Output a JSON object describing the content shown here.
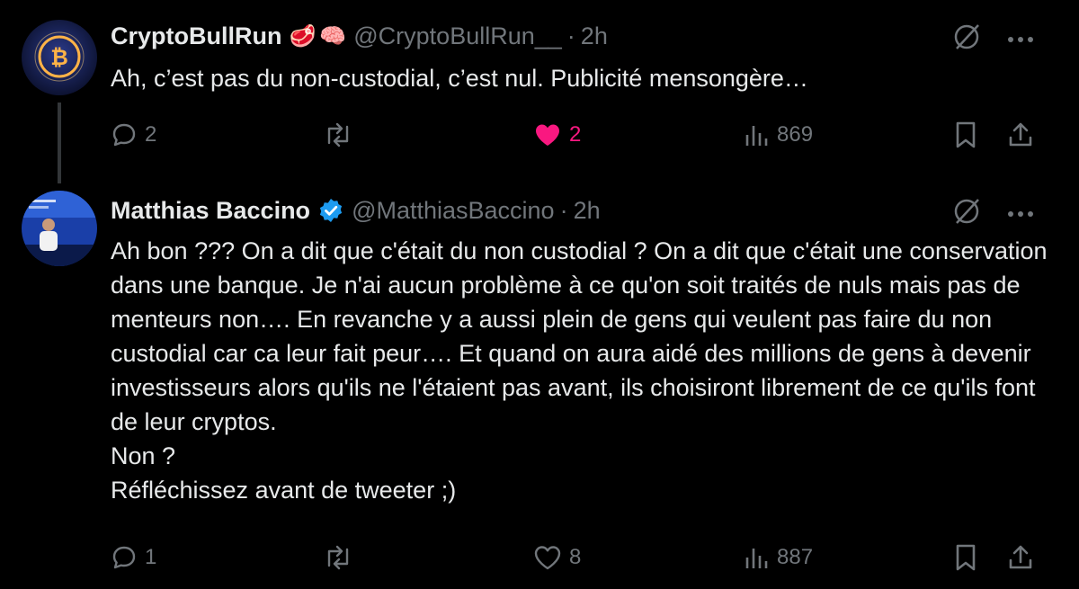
{
  "tweets": [
    {
      "name": "CryptoBullRun",
      "emoji": [
        "🥩",
        "🧠"
      ],
      "handle": "@CryptoBullRun__",
      "separator": "·",
      "time": "2h",
      "text": "Ah, c’est pas du non-custodial, c’est nul. Publicité mensongère…",
      "replies": "2",
      "retweets": "",
      "likes": "2",
      "liked": true,
      "views": "869"
    },
    {
      "name": "Matthias Baccino",
      "verified": true,
      "handle": "@MatthiasBaccino",
      "separator": "·",
      "time": "2h",
      "text": "Ah bon ??? On a dit que c'était du non custodial ? On a dit que c'était une conservation dans une banque. Je n'ai aucun problème à ce qu'on soit traités de nuls mais pas de menteurs non…. En revanche y a aussi plein de gens qui veulent pas faire du non custodial car ca leur fait peur…. Et quand on aura aidé des millions de gens à devenir investisseurs alors qu'ils ne l'étaient pas avant, ils choisiront librement de ce qu'ils font de leur cryptos.\nNon ?\nRéfléchissez avant de tweeter ;)",
      "replies": "1",
      "retweets": "",
      "likes": "8",
      "liked": false,
      "views": "887"
    }
  ],
  "colors": {
    "background": "#000000",
    "text": "#e7e9ea",
    "muted": "#71767b",
    "like": "#f91880",
    "verified": "#1d9bf0"
  }
}
